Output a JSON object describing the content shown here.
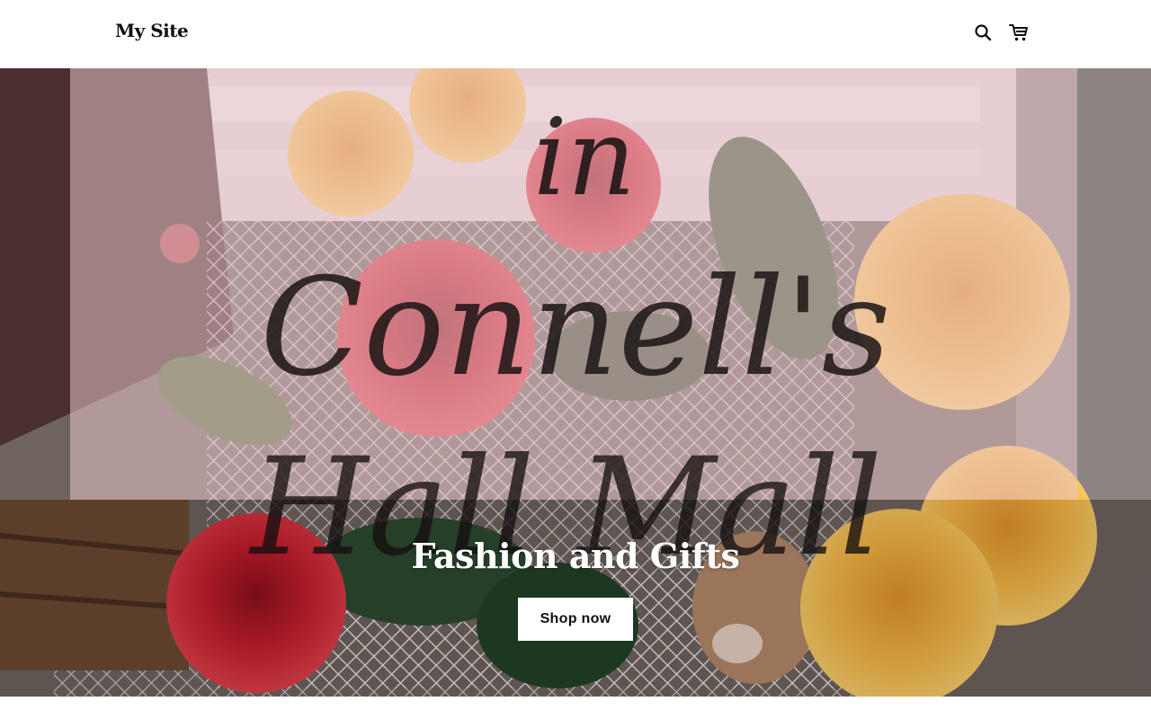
{
  "header": {
    "site_title": "My Site",
    "icons": {
      "search": "search-icon",
      "cart": "shopping-cart-icon"
    }
  },
  "hero": {
    "logo_text": [
      "in",
      "Connell's",
      "Hall Mall"
    ],
    "title": "Fashion and Gifts",
    "cta_label": "Shop now",
    "background_image": "roses-bouquet-photo"
  },
  "colors": {
    "header_bg": "#ffffff",
    "text_dark": "#111111",
    "button_bg": "#ffffff",
    "hero_title": "#ffffff",
    "rose_red": "#c0202f",
    "rose_yellow": "#f2b03a",
    "overlay_pink": "#e8c5cb"
  }
}
